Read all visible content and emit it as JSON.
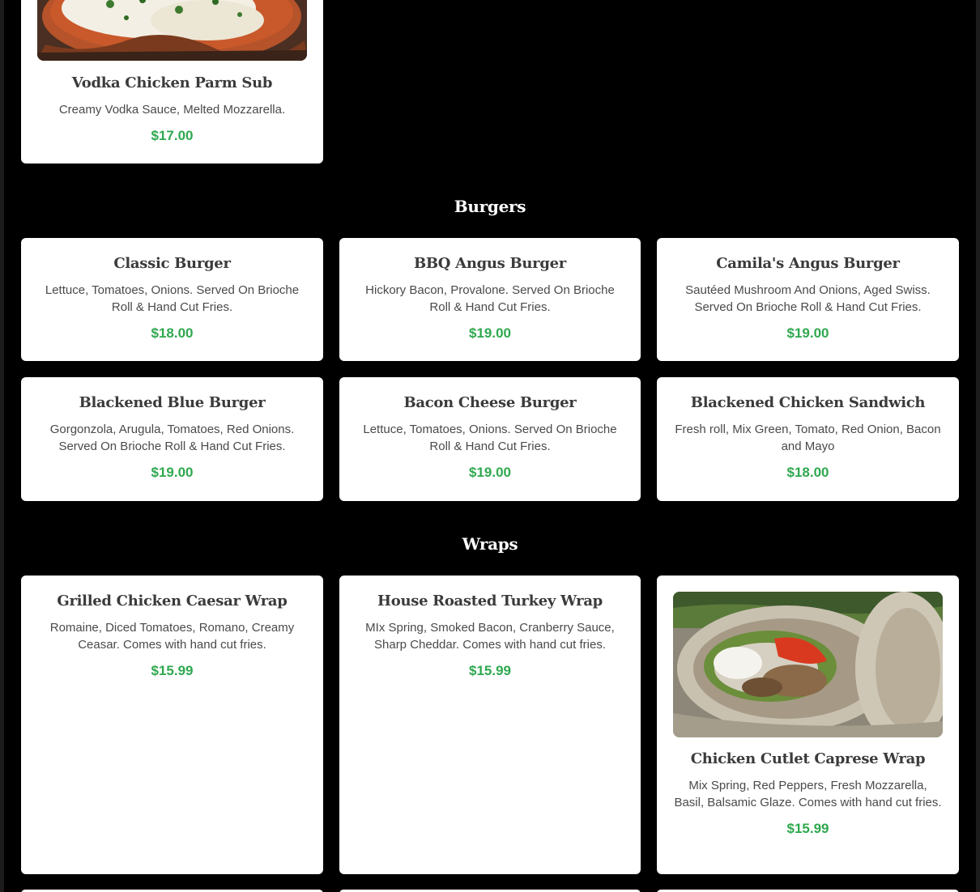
{
  "top_section": {
    "items": [
      {
        "name": "Vodka Chicken Parm Sub",
        "description": "Creamy Vodka Sauce, Melted Mozzarella.",
        "price": "$17.00",
        "image_icon": "chicken-parm-photo"
      }
    ]
  },
  "burgers": {
    "title": "Burgers",
    "items": [
      {
        "name": "Classic Burger",
        "description": "Lettuce, Tomatoes, Onions. Served On Brioche Roll & Hand Cut Fries.",
        "price": "$18.00"
      },
      {
        "name": "BBQ Angus Burger",
        "description": "Hickory Bacon, Provalone. Served On Brioche Roll & Hand Cut Fries.",
        "price": "$19.00"
      },
      {
        "name": "Camila's Angus Burger",
        "description": "Sautéed Mushroom And Onions, Aged Swiss. Served On Brioche Roll & Hand Cut Fries.",
        "price": "$19.00"
      },
      {
        "name": "Blackened Blue Burger",
        "description": "Gorgonzola, Arugula, Tomatoes, Red Onions. Served On Brioche Roll & Hand Cut Fries.",
        "price": "$19.00"
      },
      {
        "name": "Bacon Cheese Burger",
        "description": "Lettuce, Tomatoes, Onions. Served On Brioche Roll & Hand Cut Fries.",
        "price": "$19.00"
      },
      {
        "name": "Blackened Chicken Sandwich",
        "description": "Fresh roll, Mix Green, Tomato, Red Onion, Bacon and Mayo",
        "price": "$18.00"
      }
    ]
  },
  "wraps": {
    "title": "Wraps",
    "items": [
      {
        "name": "Grilled Chicken Caesar Wrap",
        "description": "Romaine, Diced Tomatoes, Romano, Creamy Ceasar. Comes with hand cut fries.",
        "price": "$15.99"
      },
      {
        "name": "House Roasted Turkey Wrap",
        "description": "MIx Spring, Smoked Bacon, Cranberry Sauce, Sharp Cheddar. Comes with hand cut fries.",
        "price": "$15.99"
      },
      {
        "name": "Chicken Cutlet Caprese Wrap",
        "description": "Mix Spring, Red Peppers, Fresh Mozzarella, Basil, Balsamic Glaze. Comes with hand cut fries.",
        "price": "$15.99",
        "image_icon": "caprese-wrap-photo"
      }
    ]
  },
  "colors": {
    "background": "#000000",
    "card": "#ffffff",
    "price": "#2fa84f",
    "heading": "#3b3b3b"
  }
}
